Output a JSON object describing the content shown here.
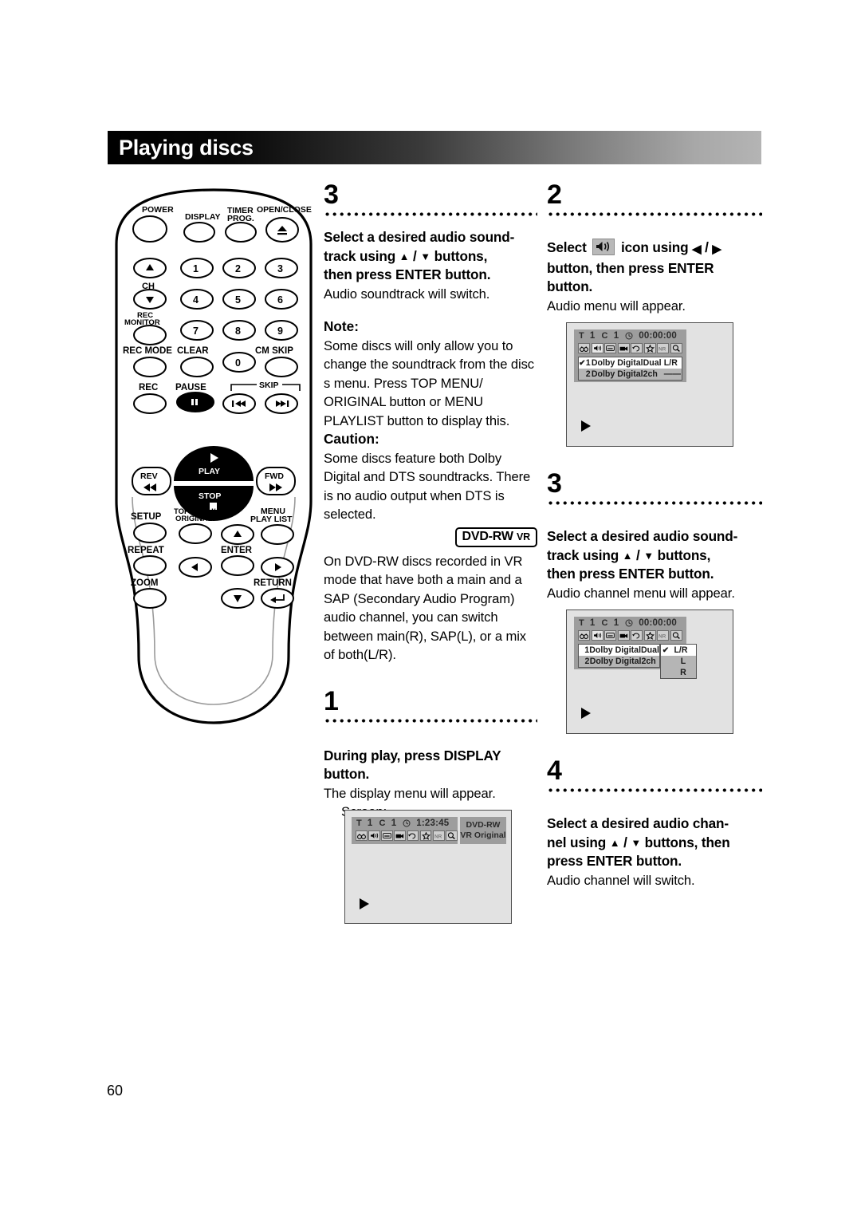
{
  "page": {
    "title": "Playing discs",
    "number": "60"
  },
  "remote": {
    "name": "dvd-recorder-remote-control",
    "buttons": [
      {
        "label": "POWER"
      },
      {
        "label": "DISPLAY"
      },
      {
        "label": "TIMER PROG."
      },
      {
        "label": "OPEN/CLOSE"
      },
      {
        "label": "CH"
      },
      {
        "label": "REC MONITOR"
      },
      {
        "label": "REC MODE"
      },
      {
        "label": "CLEAR"
      },
      {
        "label": "CM SKIP"
      },
      {
        "label": "REC"
      },
      {
        "label": "PAUSE"
      },
      {
        "label": "SKIP"
      },
      {
        "label": "PLAY"
      },
      {
        "label": "STOP"
      },
      {
        "label": "REV"
      },
      {
        "label": "FWD"
      },
      {
        "label": "SETUP"
      },
      {
        "label": "TOP MENU/ ORIGINAL"
      },
      {
        "label": "MENU PLAY LIST"
      },
      {
        "label": "REPEAT"
      },
      {
        "label": "ENTER"
      },
      {
        "label": "ZOOM"
      },
      {
        "label": "RETURN"
      }
    ],
    "labels": {
      "power": "POWER",
      "display": "DISPLAY",
      "timer_prog_l1": "TIMER",
      "timer_prog_l2": "PROG.",
      "open_close": "OPEN/CLOSE",
      "ch": "CH",
      "rec_monitor_l1": "REC",
      "rec_monitor_l2": "MONITOR",
      "rec_mode": "REC MODE",
      "clear": "CLEAR",
      "cm_skip": "CM SKIP",
      "rec": "REC",
      "pause": "PAUSE",
      "skip": "SKIP",
      "play": "PLAY",
      "stop": "STOP",
      "rev": "REV",
      "fwd": "FWD",
      "setup": "SETUP",
      "top_menu_l1": "TOP MENU/",
      "top_menu_l2": "ORIGINAL",
      "menu_playlist_l1": "MENU",
      "menu_playlist_l2": "PLAY LIST",
      "repeat": "REPEAT",
      "enter": "ENTER",
      "zoom": "ZOOM",
      "return": "RETURN"
    },
    "keypad": [
      "1",
      "2",
      "3",
      "4",
      "5",
      "6",
      "7",
      "8",
      "9",
      "0"
    ]
  },
  "middle_column": {
    "step3": {
      "number": "3",
      "heading_l1": "Select a desired audio sound-",
      "heading_l2a": "track using ",
      "heading_l2b": " / ",
      "heading_l2c": " buttons,",
      "heading_l3": "then press ENTER button.",
      "body": "Audio soundtrack will switch."
    },
    "note": {
      "label": "Note:",
      "text": "Some discs will only allow you to change the soundtrack from the disc s menu. Press TOP MENU/ ORIGINAL button or MENU PLAYLIST button to display this."
    },
    "caution": {
      "label": "Caution:",
      "text": "Some discs feature both Dolby Digital and DTS soundtracks. There is no audio output when DTS is selected."
    },
    "badge": {
      "main": "DVD-RW",
      "sub": "VR"
    },
    "vr_text": "On DVD-RW discs recorded in VR mode that have both a main and a SAP (Secondary Audio Program) audio channel, you can switch between main(R), SAP(L), or a mix of both(L/R).",
    "step1": {
      "number": "1",
      "heading_l1": "During play, press DISPLAY",
      "heading_l2": "button.",
      "body": "The display menu will appear.",
      "screen_label": "Screen:"
    },
    "screen1": {
      "title_mark": "T",
      "title_num": "1",
      "chapter_mark": "C",
      "chapter_num": "1",
      "time": "1:23:45",
      "disc_type_l1": "DVD-RW",
      "disc_type_l2": "VR Original",
      "icons": [
        "binoculars-icon",
        "speaker-icon",
        "subtitle-icon",
        "angle-icon",
        "repeat-icon",
        "marker-icon",
        "nr-icon",
        "zoom-icon"
      ]
    }
  },
  "right_column": {
    "step2": {
      "number": "2",
      "heading_a": "Select ",
      "heading_b": " icon using ",
      "heading_c": " / ",
      "heading_d": "",
      "heading_l2": "button, then press ENTER",
      "heading_l3": "button.",
      "body": "Audio menu will appear."
    },
    "screen2": {
      "title_mark": "T",
      "title_num": "1",
      "chapter_mark": "C",
      "chapter_num": "1",
      "time": "00:00:00",
      "icons": [
        "binoculars-icon",
        "speaker-icon",
        "subtitle-icon",
        "angle-icon",
        "repeat-icon",
        "marker-icon",
        "nr-icon",
        "zoom-icon"
      ],
      "audio_rows": [
        {
          "check": "✔",
          "index": "1",
          "name": "Dolby Digital",
          "mode": "Dual",
          "channel": "L/R",
          "highlighted": true
        },
        {
          "check": "",
          "index": "2",
          "name": "Dolby Digital",
          "mode": "2ch",
          "channel": "——",
          "highlighted": false
        }
      ]
    },
    "step3": {
      "number": "3",
      "heading_l1": "Select a desired audio sound-",
      "heading_l2a": "track using ",
      "heading_l2b": " / ",
      "heading_l2c": " buttons,",
      "heading_l3": "then press ENTER button.",
      "body": "Audio channel menu will appear."
    },
    "screen3": {
      "title_mark": "T",
      "title_num": "1",
      "chapter_mark": "C",
      "chapter_num": "1",
      "time": "00:00:00",
      "icons": [
        "binoculars-icon",
        "speaker-icon",
        "subtitle-icon",
        "angle-icon",
        "repeat-icon",
        "marker-icon",
        "nr-icon",
        "zoom-icon"
      ],
      "audio_rows": [
        {
          "check": "",
          "index": "1",
          "name": "Dolby Digital",
          "mode": "Dual",
          "highlighted": true
        },
        {
          "check": "",
          "index": "2",
          "name": "Dolby Digital",
          "mode": "2ch",
          "highlighted": false
        }
      ],
      "channel_rows": [
        {
          "check": "✔",
          "label": "L/R",
          "highlighted": true
        },
        {
          "check": "",
          "label": "L",
          "highlighted": false
        },
        {
          "check": "",
          "label": "R",
          "highlighted": false
        }
      ]
    },
    "step4": {
      "number": "4",
      "heading_l1": "Select a desired audio chan-",
      "heading_l2a": "nel using ",
      "heading_l2b": " / ",
      "heading_l2c": " buttons, then",
      "heading_l3": "press ENTER button.",
      "body": "Audio channel will switch."
    }
  }
}
